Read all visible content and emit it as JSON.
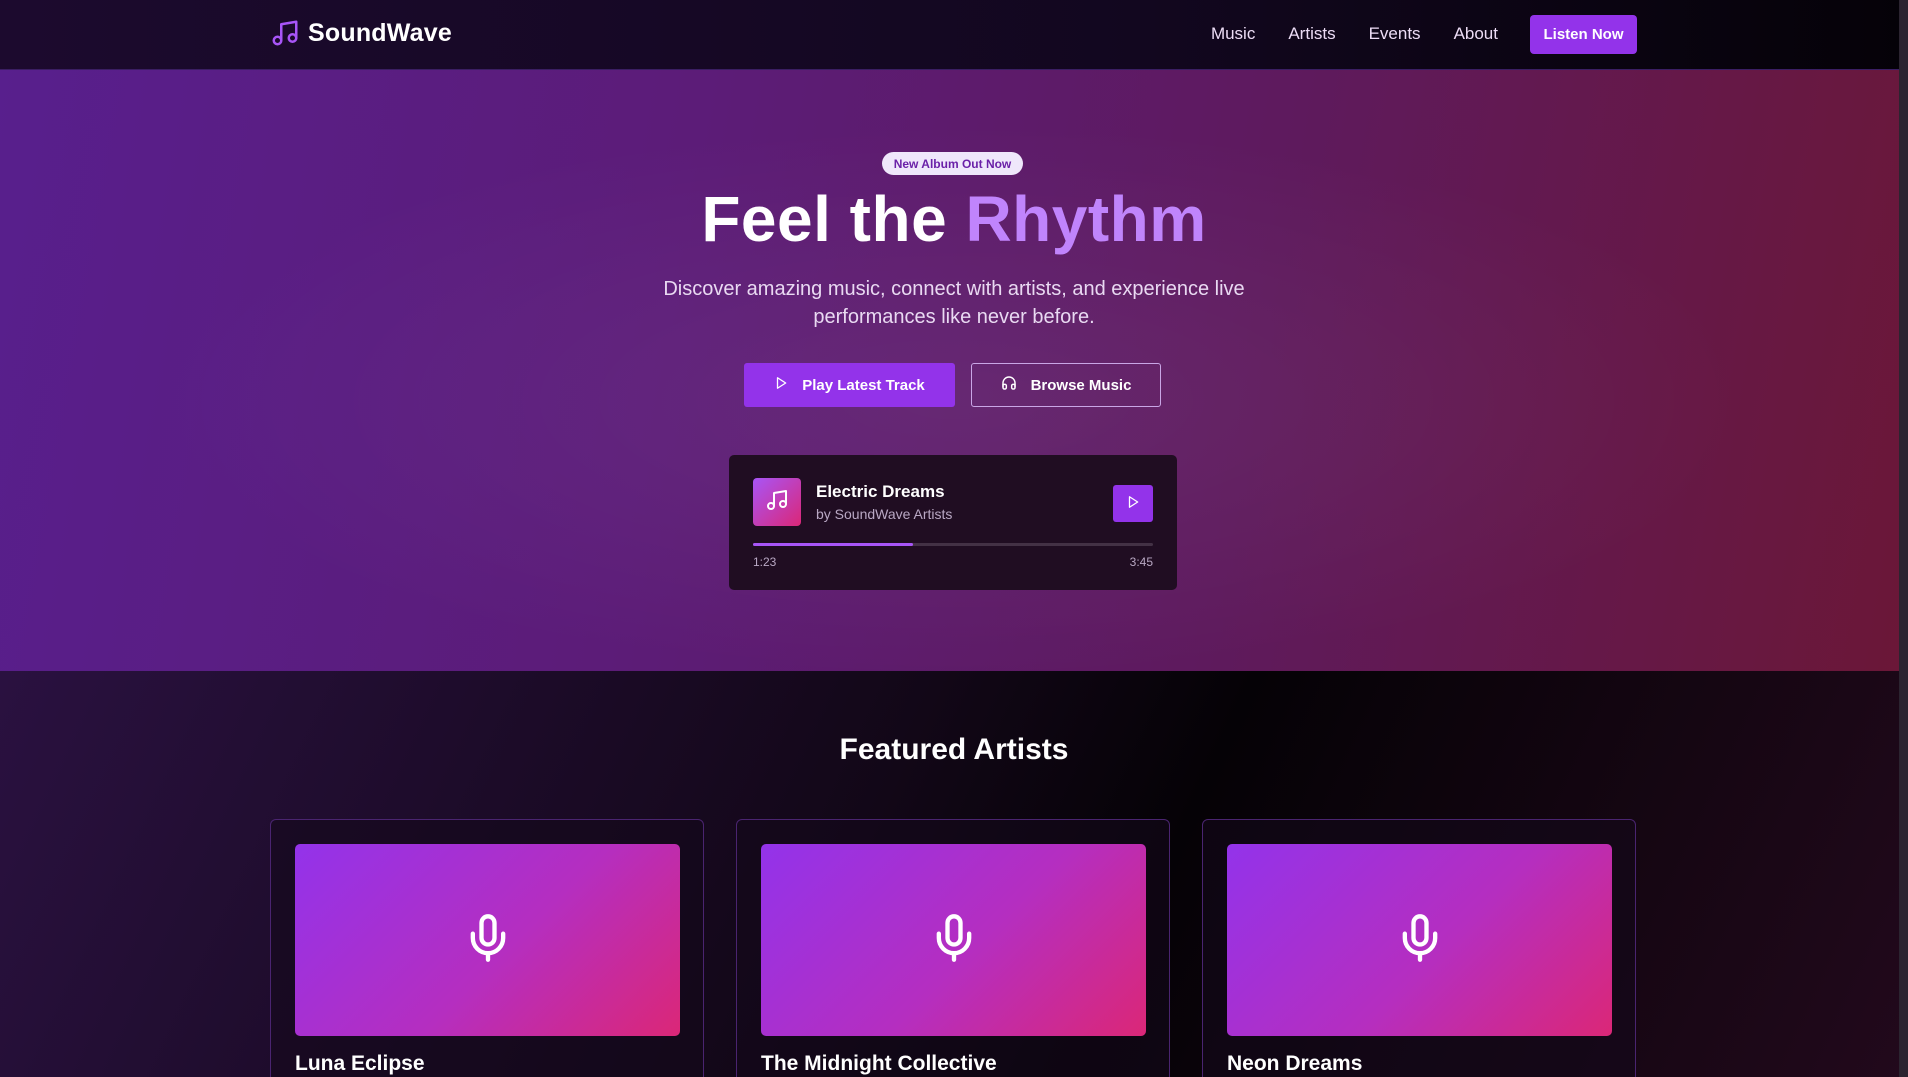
{
  "nav": {
    "brand": "SoundWave",
    "links": [
      "Music",
      "Artists",
      "Events",
      "About"
    ],
    "cta": "Listen Now"
  },
  "hero": {
    "badge": "New Album Out Now",
    "title_main": "Feel the ",
    "title_accent": "Rhythm",
    "subtitle": "Discover amazing music, connect with artists, and experience live performances like never before.",
    "primary_button": "Play Latest Track",
    "secondary_button": "Browse Music"
  },
  "player": {
    "track_title": "Electric Dreams",
    "track_artist": "by SoundWave Artists",
    "elapsed": "1:23",
    "total": "3:45",
    "progress": 0.4
  },
  "featured": {
    "title": "Featured Artists",
    "artists": [
      {
        "name": "Luna Eclipse"
      },
      {
        "name": "The Midnight Collective"
      },
      {
        "name": "Neon Dreams"
      }
    ]
  },
  "colors": {
    "accent": "#9333ea",
    "accent_light": "#c084fc",
    "pink": "#db2777"
  },
  "icons": {
    "brand": "music-note-icon",
    "play": "play-icon",
    "browse": "headphones-icon",
    "artist": "microphone-icon"
  }
}
